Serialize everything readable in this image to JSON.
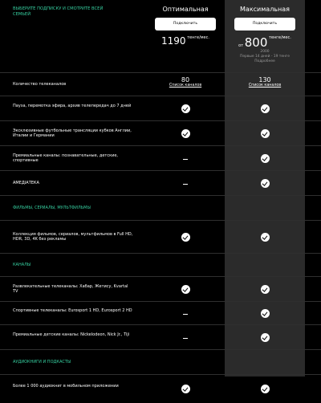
{
  "intro": "ВЫБЕРИТЕ ПОДПИСКУ И СМОТРИТЕ ВСЕЙ СЕМЬЕЙ",
  "plans": {
    "opt": {
      "name": "Оптимальная",
      "button": "Подключить",
      "price": "1190",
      "unit": "тенге/мес."
    },
    "max": {
      "name": "Максимальная",
      "button": "Подключить",
      "from": "от",
      "price": "800",
      "unit": "тенге/мес.",
      "unit2": "2000",
      "note1": "Первые 14 дней - 19 тенге",
      "note2": "Подробнее"
    }
  },
  "rows": [
    {
      "type": "feature",
      "label": "Количество телеканалов",
      "opt": "count",
      "max": "count",
      "opt_count": "80",
      "max_count": "130",
      "opt_link": "Список каналов",
      "max_link": "Список каналов"
    },
    {
      "type": "feature",
      "label": "Пауза, перемотка эфира, архив телепередач до 7 дней",
      "opt": "check",
      "max": "check"
    },
    {
      "type": "feature",
      "label": "Эксклюзивные футбольные трансляции кубков Англии, Италии и Германии",
      "opt": "check",
      "max": "check"
    },
    {
      "type": "feature",
      "label": "Премиальные каналы: познавательные, детские, спортивные",
      "opt": "dash",
      "max": "check"
    },
    {
      "type": "feature",
      "label": "АМЕДIАТЕКА",
      "opt": "dash",
      "max": "check"
    },
    {
      "type": "section",
      "label": "ФИЛЬМЫ, СЕРИАЛЫ, МУЛЬТФИЛЬМЫ"
    },
    {
      "type": "feature",
      "label": "Коллекция фильмов, сериалов, мультфильмов в Full HD, HDR, 3D, 4K без рекламы",
      "opt": "check",
      "max": "check"
    },
    {
      "type": "section",
      "label": "КАНАЛЫ"
    },
    {
      "type": "feature",
      "label": "Развлекательные телеканалы: Хабар, Жетису, Kvartal TV",
      "opt": "check",
      "max": "check"
    },
    {
      "type": "feature",
      "label": "Спортивные телеканалы: Eurosport 1 HD, Eurosport 2 HD",
      "opt": "dash",
      "max": "check"
    },
    {
      "type": "feature",
      "label": "Премиальные детские каналы: Nickelodeon, Nick Jr., Tiji",
      "opt": "dash",
      "max": "check"
    },
    {
      "type": "section",
      "label": "АУДИОКНИГИ И ПОДКАСТЫ"
    },
    {
      "type": "feature",
      "label": "Более 1 000 аудиокниг в мобильном приложении",
      "opt": "check",
      "max": "check"
    }
  ]
}
